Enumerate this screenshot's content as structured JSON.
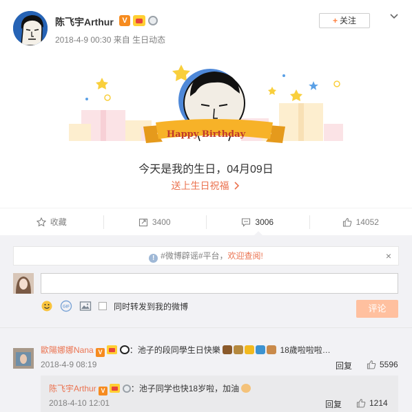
{
  "post": {
    "user_name": "陈飞宇Arthur",
    "badge_v": "V",
    "meta": "2018-4-9 00:30 来自 生日动态",
    "follow_label": "关注"
  },
  "card": {
    "banner_text": "Happy Birthday",
    "birthday_text": "今天是我的生日，04月09日",
    "wish_link": "送上生日祝福"
  },
  "actions": [
    {
      "label": "收藏",
      "icon": "star-icon"
    },
    {
      "label": "3400",
      "icon": "forward-icon"
    },
    {
      "label": "3006",
      "icon": "comment-icon"
    },
    {
      "label": "14052",
      "icon": "thumbs-up-icon"
    }
  ],
  "notice": {
    "text": "#微博辟谣#平台，",
    "link": "欢迎查阅!",
    "close": "×"
  },
  "composer": {
    "forward_label": "同时转发到我的微博",
    "submit_label": "评论"
  },
  "comments": [
    {
      "user": "歐陽娜娜Nana",
      "text_a": "：池子的段同學生日快樂",
      "text_b": "18歲啦啦啦…",
      "time": "2018-4-9 08:19",
      "reply": "回复",
      "likes": "5596"
    }
  ],
  "reply": {
    "user": "陈飞宇Arthur",
    "text": "：池子同学也快18岁啦，加油",
    "time": "2018-4-10 12:01",
    "reply": "回复",
    "likes": "1214"
  },
  "colors": {
    "accent": "#eb7350",
    "follow_plus": "#ff8140",
    "submit_disabled": "#ffc09f",
    "banner_ribbon": "#f7b228"
  }
}
